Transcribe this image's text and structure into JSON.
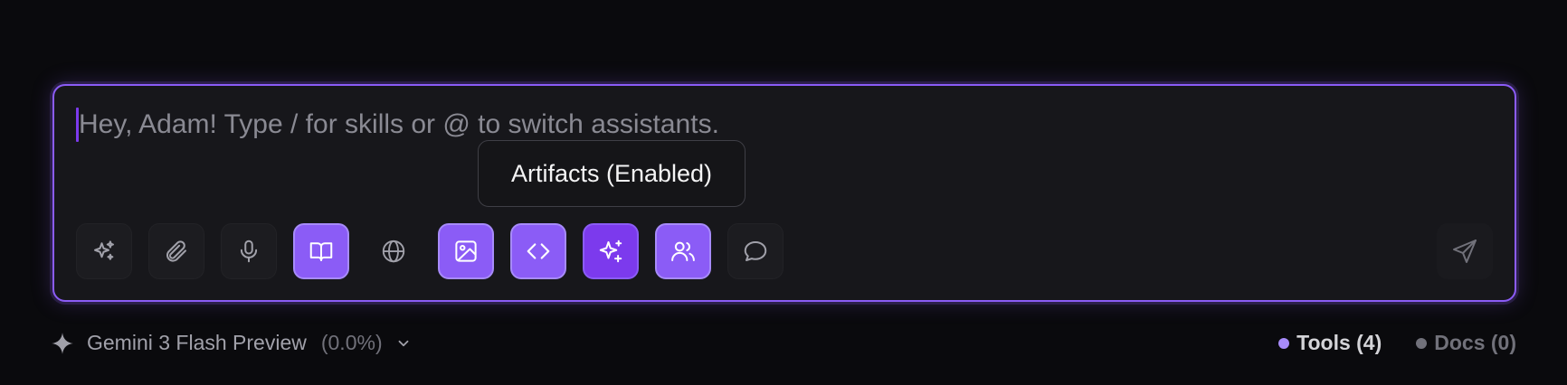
{
  "composer": {
    "placeholder": "Hey, Adam! Type / for skills or @ to switch assistants.",
    "value": "",
    "tooltip": "Artifacts (Enabled)",
    "toolbar": [
      {
        "name": "skills",
        "icon": "sparkles-icon",
        "state": "off"
      },
      {
        "name": "attach",
        "icon": "paperclip-icon",
        "state": "off"
      },
      {
        "name": "voice",
        "icon": "microphone-icon",
        "state": "off"
      },
      {
        "name": "knowledge",
        "icon": "book-icon",
        "state": "on"
      },
      {
        "name": "web-search",
        "icon": "globe-icon",
        "state": "off"
      },
      {
        "name": "image-generation",
        "icon": "image-icon",
        "state": "on"
      },
      {
        "name": "artifacts",
        "icon": "code-icon",
        "state": "on"
      },
      {
        "name": "magic",
        "icon": "sparkle-plus-icon",
        "state": "on-deep"
      },
      {
        "name": "assistants",
        "icon": "users-icon",
        "state": "on"
      },
      {
        "name": "chat",
        "icon": "chat-bubble-icon",
        "state": "off"
      }
    ],
    "send_icon": "send-icon"
  },
  "footer": {
    "model_icon": "four-point-star-icon",
    "model_name": "Gemini 3 Flash Preview",
    "model_usage": "(0.0%)",
    "tools_label": "Tools (4)",
    "docs_label": "Docs (0)"
  },
  "colors": {
    "accent": "#8b5cf6",
    "accent_deep": "#7c3aed",
    "background": "#0a0a0d",
    "panel": "#17171b"
  }
}
